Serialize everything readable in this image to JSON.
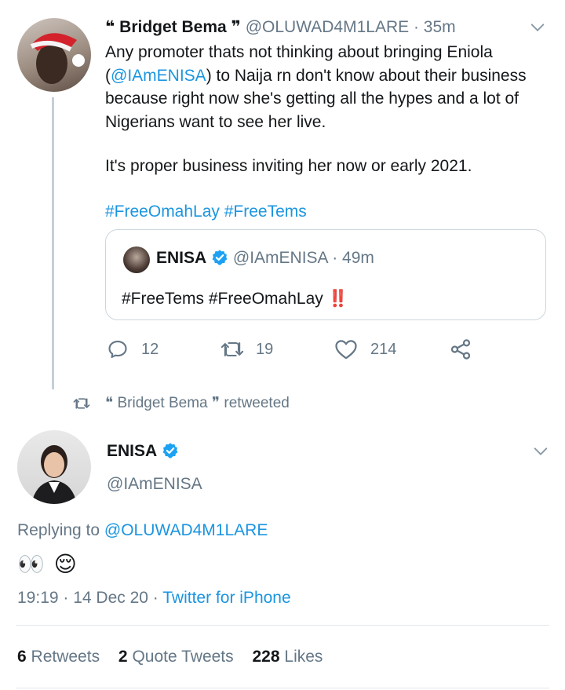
{
  "reply_tweet": {
    "display_name": "❝ Bridget Bema ❞",
    "handle": "@OLUWAD4M1LARE",
    "time": "· 35m",
    "text_before_mention": "Any promoter thats not thinking about bringing Eniola\n(",
    "mention": "@IAmENISA",
    "text_after_mention": ") to Naija rn don't know about their business because right now she's getting all the hypes and a lot of Nigerians want to see her live.",
    "text_paragraph_2": "It's proper business inviting her now or early 2021.",
    "hashtags": "#FreeOmahLay #FreeTems",
    "quoted": {
      "display_name": "ENISA",
      "handle": "@IAmENISA",
      "time": "· 49m",
      "text": "#FreeTems #FreeOmahLay",
      "emoji": "‼️"
    },
    "actions": {
      "replies": "12",
      "retweets": "19",
      "likes": "214"
    }
  },
  "retweet_context": {
    "label": "❝ Bridget Bema ❞ retweeted"
  },
  "main_tweet": {
    "display_name": "ENISA",
    "handle": "@IAmENISA",
    "replying_prefix": "Replying to",
    "replying_to": "@OLUWAD4M1LARE",
    "text": "👀 😌",
    "timestamp": "19:19 · 14 Dec 20 ·",
    "source": "Twitter for iPhone",
    "stats": {
      "retweets_count": "6",
      "retweets_label": "Retweets",
      "quotes_count": "2",
      "quotes_label": "Quote Tweets",
      "likes_count": "228",
      "likes_label": "Likes"
    }
  },
  "colors": {
    "accent": "#1b95e0",
    "muted": "#657786",
    "verified": "#1da1f2",
    "emoji_red": "#e0245e"
  },
  "icons": [
    "reply-icon",
    "retweet-icon",
    "like-icon",
    "share-icon",
    "verified-icon",
    "chevron-down-icon"
  ]
}
